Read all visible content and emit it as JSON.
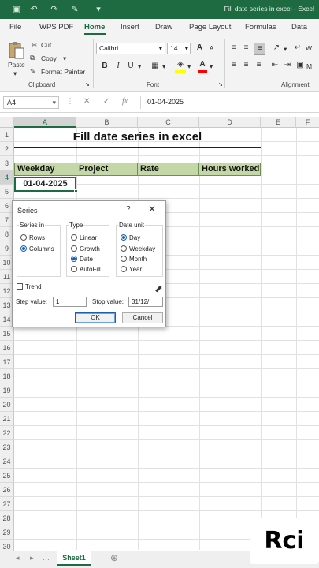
{
  "window": {
    "title": "Fill date series in excel  -  Excel",
    "qat_icons": [
      "save-icon",
      "undo-icon",
      "redo-icon",
      "format-painter-icon",
      "customize-icon"
    ]
  },
  "menu": {
    "tabs": [
      "File",
      "WPS PDF",
      "Home",
      "Insert",
      "Draw",
      "Page Layout",
      "Formulas",
      "Data"
    ],
    "active_tab": "Home"
  },
  "ribbon": {
    "clipboard": {
      "paste": "Paste",
      "cut": "Cut",
      "copy": "Copy",
      "format_painter": "Format Painter",
      "group_label": "Clipboard"
    },
    "font": {
      "font_name": "Calibri",
      "font_size": "14",
      "bold": "B",
      "italic": "I",
      "underline": "U",
      "grow": "A",
      "shrink": "A",
      "fill_color": "#ffff00",
      "font_color": "#ff0000",
      "group_label": "Font"
    },
    "alignment": {
      "group_label": "Alignment",
      "wrap_hint": "W",
      "merge_hint": "M"
    }
  },
  "formula_bar": {
    "name_box": "A4",
    "formula": "01-04-2025"
  },
  "grid": {
    "columns": [
      "A",
      "B",
      "C",
      "D",
      "E",
      "F"
    ],
    "rows": [
      "1",
      "2",
      "3",
      "4",
      "5",
      "6",
      "7",
      "8",
      "9",
      "10",
      "11",
      "12",
      "13",
      "14",
      "15",
      "16",
      "17",
      "18",
      "19",
      "20",
      "21",
      "22",
      "23",
      "24",
      "25",
      "26",
      "27",
      "28",
      "29",
      "30"
    ],
    "selected_column": "A",
    "selected_row": "4"
  },
  "sheet": {
    "title": "Fill date series in excel",
    "headers": [
      "Weekday",
      "Project",
      "Rate",
      "Hours worked"
    ],
    "header_fill": "#c3d7a7",
    "active_cell_value": "01-04-2025"
  },
  "dialog": {
    "title": "Series",
    "help": "?",
    "close": "✕",
    "series_in": {
      "label": "Series in",
      "options": [
        "Rows",
        "Columns"
      ],
      "selected": "Columns"
    },
    "type": {
      "label": "Type",
      "options": [
        "Linear",
        "Growth",
        "Date",
        "AutoFill"
      ],
      "selected": "Date"
    },
    "date_unit": {
      "label": "Date unit",
      "options": [
        "Day",
        "Weekday",
        "Month",
        "Year"
      ],
      "selected": "Day"
    },
    "trend_label": "Trend",
    "step_value_label": "Step value:",
    "step_value": "1",
    "stop_value_label": "Stop value:",
    "stop_value": "31/12/",
    "ok": "OK",
    "cancel": "Cancel"
  },
  "sheet_tabs": {
    "active": "Sheet1"
  },
  "watermark": "Rci"
}
